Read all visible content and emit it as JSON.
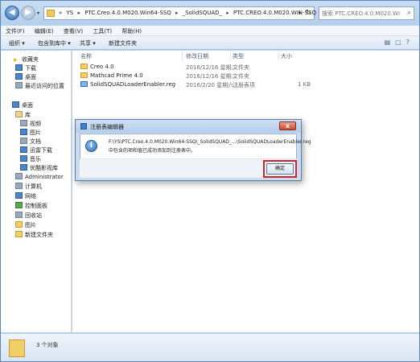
{
  "address": {
    "crumbs": [
      "«",
      "YS",
      "PTC.Creo.4.0.M020.Win64-SSQ",
      "_SolidSQUAD_",
      "PTC.CREO.4.0.M020.WIN-SSQ"
    ],
    "search_placeholder": "搜索 PTC.CREO.4.0.M020.WIN-SSQ"
  },
  "menu": [
    "文件(F)",
    "编辑(E)",
    "查看(V)",
    "工具(T)",
    "帮助(H)"
  ],
  "toolbar": {
    "organize": "组织 ▾",
    "include_library": "包含到库中 ▾",
    "share": "共享 ▾",
    "new_folder": "新建文件夹"
  },
  "nav": {
    "favorites": "收藏夹",
    "downloads": "下载",
    "desktop": "桌面",
    "recent": "最近访问的位置",
    "desktop2": "桌面",
    "library": "库",
    "videos": "视频",
    "pictures": "图片",
    "docs": "文档",
    "thunder": "迅雷下载",
    "music": "音乐",
    "youku": "优酷影视库",
    "admin": "Administrator",
    "computer": "计算机",
    "network": "网络",
    "control": "控制面板",
    "recycle": "回收站",
    "pictures2": "图片",
    "newfolder": "新建文件夹"
  },
  "columns": {
    "name": "名称",
    "date": "修改日期",
    "type": "类型",
    "size": "大小"
  },
  "files": [
    {
      "name": "Creo 4.0",
      "date": "2016/12/16 星期...",
      "type": "文件夹",
      "size": ""
    },
    {
      "name": "Mathcad Prime 4.0",
      "date": "2016/12/16 星期...",
      "type": "文件夹",
      "size": ""
    },
    {
      "name": "SolidSQUADLoaderEnabler.reg",
      "date": "2016/2/20 星期六...",
      "type": "注册表项",
      "size": "1 KB"
    }
  ],
  "status": "3 个对象",
  "dialog": {
    "title": "注册表编辑器",
    "line1": "F:\\YS\\PTC.Creo.4.0.M020.Win64-SSQ\\_SolidSQUAD_...\\SolidSQUADLoaderEnabler.reg",
    "line2": "中包含的项和值已成功添加到注册表中。",
    "ok": "确定",
    "close": "x",
    "icon": "i"
  }
}
